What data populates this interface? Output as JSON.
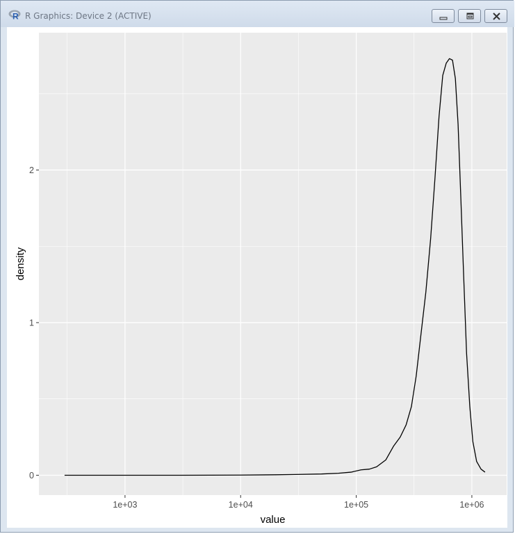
{
  "window": {
    "title": "R Graphics: Device 2 (ACTIVE)",
    "icon": "r-logo-icon",
    "controls": [
      "minimize-icon",
      "restore-icon",
      "close-icon"
    ]
  },
  "colors": {
    "panel": "#ebebeb",
    "grid": "#ffffff",
    "line": "#000000",
    "text": "#4d4d4d",
    "title_text": "#6d7684"
  },
  "chart_data": {
    "type": "line",
    "xlabel": "value",
    "ylabel": "density",
    "x_scale": "log10",
    "x_ticks": [
      1000,
      10000,
      100000,
      1000000
    ],
    "x_tick_labels": [
      "1e+03",
      "1e+04",
      "1e+05",
      "1e+06"
    ],
    "y_ticks": [
      0,
      1,
      2
    ],
    "y_tick_labels": [
      "0",
      "1",
      "2"
    ],
    "xlim": [
      180,
      2000000
    ],
    "ylim": [
      -0.13,
      2.9
    ],
    "grid": true,
    "legend": "none",
    "series": [
      {
        "x": [
          300,
          1000,
          3000,
          10000,
          20000,
          30000,
          50000,
          70000,
          90000,
          110000,
          130000,
          150000,
          180000,
          210000,
          240000,
          270000,
          300000,
          330000,
          360000,
          400000,
          440000,
          480000,
          520000,
          560000,
          600000,
          640000,
          680000,
          720000,
          760000,
          800000,
          850000,
          900000,
          960000,
          1020000,
          1100000,
          1200000,
          1300000
        ],
        "y": [
          0,
          0,
          0,
          0.001,
          0.003,
          0.005,
          0.008,
          0.013,
          0.02,
          0.035,
          0.04,
          0.055,
          0.1,
          0.19,
          0.25,
          0.33,
          0.45,
          0.65,
          0.9,
          1.2,
          1.55,
          1.95,
          2.35,
          2.62,
          2.7,
          2.73,
          2.72,
          2.6,
          2.3,
          1.85,
          1.3,
          0.8,
          0.45,
          0.22,
          0.09,
          0.04,
          0.02
        ]
      }
    ]
  }
}
